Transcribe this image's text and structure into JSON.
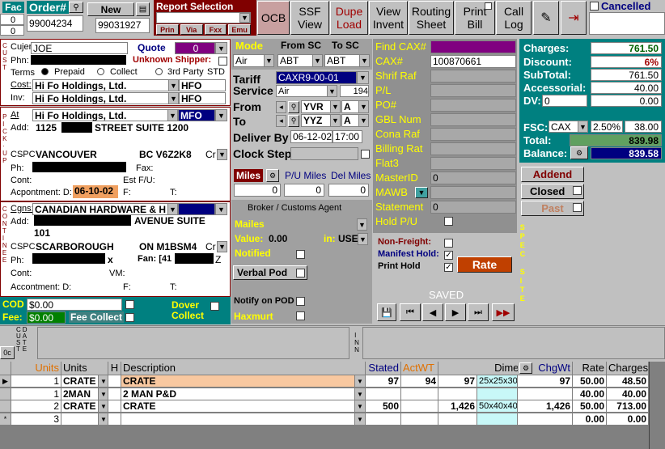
{
  "toolbar": {
    "fac_label": "Fac",
    "fac_values": [
      "0",
      "0"
    ],
    "order_label": "Order#",
    "order_value": "99004234",
    "new_label": "New",
    "new_value": "99031927",
    "report_title": "Report Selection",
    "report_buttons": [
      "Prin",
      "Via",
      "Fxx",
      "Emu"
    ],
    "buttons": [
      {
        "l1": "OCB",
        "l2": ""
      },
      {
        "l1": "SSF",
        "l2": "View"
      },
      {
        "l1": "Dupe",
        "l2": "Load"
      },
      {
        "l1": "View",
        "l2": "Invent"
      },
      {
        "l1": "Routing",
        "l2": "Sheet"
      },
      {
        "l1": "Print",
        "l2": "Bill"
      },
      {
        "l1": "Call",
        "l2": "Log"
      }
    ],
    "cancelled_label": "Cancelled"
  },
  "cust": {
    "side": "CUST",
    "cujer_label": "Cujer",
    "cujer_value": "JOE",
    "quote_label": "Quote",
    "quote_value": "0",
    "phn_label": "Phn:",
    "unknown_shipper": "Unknown Shipper:",
    "terms_label": "Terms",
    "terms": [
      "Prepaid",
      "Collect",
      "3rd Party"
    ],
    "std": "STD",
    "cost_label": "Cost:",
    "cost_value": "Hi Fo Holdings, Ltd.",
    "cost_code": "HFO",
    "inv_label": "Inv:",
    "inv_value": "Hi Fo Holdings, Ltd.",
    "inv_code": "HFO"
  },
  "pickup": {
    "side": "PICK-UP",
    "at_label": "At",
    "at_value": "Hi Fo Holdings, Ltd.",
    "at_code": "MFO",
    "add_label": "Add:",
    "add_pre": "1125",
    "add_post": "STREET SUITE 1200",
    "cspc_label": "CSPC",
    "city": "VANCOUVER",
    "prov": "BC V6Z2K8",
    "cr": "Cr",
    "ph_label": "Ph:",
    "fax_label": "Fax:",
    "cont_label": "Cont:",
    "estfu_label": "Est F/U:",
    "appt_label": "Acpontment: D:",
    "appt_date": "06-10-02",
    "f_label": "F:",
    "t_label": "T:"
  },
  "consignee": {
    "side": "CONTINEE",
    "cgns_label": "Cgns:",
    "cgns_value": "CANADIAN HARDWARE & H",
    "add_label": "Add:",
    "add_post": "AVENUE SUITE",
    "add_line2": "101",
    "cspc_label": "CSPC",
    "city": "SCARBOROUGH",
    "prov": "ON M1BSM4",
    "cr": "Cr",
    "ph_label": "Ph:",
    "ph_suffix": "x",
    "fax_label": "Fan: [41",
    "fax_suffix": "Z",
    "cont_label": "Cont:",
    "vm_label": "VM:",
    "appt_label": "Accontment: D:",
    "f_label": "F:",
    "t_label": "T:"
  },
  "cod": {
    "cod_label": "COD",
    "cod_value": "$0.00",
    "fee_label": "Fee:",
    "fee_value": "$0.00",
    "fee_collect": "Fee Collect",
    "dover": "Dover",
    "collect": "Collect"
  },
  "mode": {
    "title": "Mode",
    "from_label": "From SC",
    "to_label": "To SC",
    "mode_value": "Air",
    "from_value": "ABT",
    "to_value": "ABT"
  },
  "tariff": {
    "tariff_label": "Tariff",
    "tariff_value": "CAXR9-00-01",
    "service_label": "Service",
    "service_value": "Air",
    "service_num": "194",
    "from_label": "From",
    "from_value": "YVR",
    "from_code": "A",
    "to_label": "To",
    "to_value": "YYZ",
    "to_code": "A",
    "deliver_label": "Deliver By",
    "deliver_date": "06-12-02",
    "deliver_time": "17:00",
    "clock_label": "Clock Step"
  },
  "miles": {
    "miles_label": "Miles",
    "pu_label": "P/U Miles",
    "del_label": "Del Miles",
    "miles_value": "0",
    "pu_value": "0",
    "del_value": "0"
  },
  "broker": {
    "title": "Broker / Customs Agent",
    "mailes": "Mailes",
    "value_label": "Value:",
    "value": "0.00",
    "in_label": "in:",
    "currency": "USE",
    "notified": "Notified",
    "verbal": "Verbal Pod",
    "notify_pod": "Notify on POD",
    "haxmurt": "Haxmurt"
  },
  "refs": {
    "labels": [
      "Find CAX#",
      "CAX#",
      "Shrif Raf",
      "P/L",
      "PO#",
      "GBL Num",
      "Cona Raf",
      "Billing Rat",
      "Flat3",
      "MasterID",
      "MAWB",
      "Statement",
      "Hold P/U"
    ],
    "cax_value": "100870661",
    "masterid_value": "0",
    "statement_value": "0"
  },
  "flags": {
    "nonfreight": "Non-Freight:",
    "manifest": "Manifest Hold:",
    "printhold": "Print Hold",
    "rate": "Rate",
    "saved": "SAVED",
    "spec_site": "SPEC SITE"
  },
  "charges": {
    "charges_label": "Charges:",
    "charges_value": "761.50",
    "discount_label": "Discount:",
    "discount_value": "6%",
    "subtotal_label": "SubTotal:",
    "subtotal_value": "761.50",
    "accessorial_label": "Accessorial:",
    "accessorial_value": "40.00",
    "dv_label": "DV:",
    "dv_value": "0",
    "dv_amount": "0.00",
    "fsc_label": "FSC:",
    "fsc_type": "CAX",
    "fsc_pct": "2.50%",
    "fsc_value": "38.00",
    "total_label": "Total:",
    "total_value": "839.98",
    "balance_label": "Balance:",
    "balance_value": "839.58",
    "addend": "Addend",
    "closed": "Closed",
    "past": "Past"
  },
  "grid": {
    "headers": [
      "Units",
      "Units",
      "H",
      "Description",
      "Stated",
      "ActWT",
      "Dimensions",
      "ChgWt",
      "Rate",
      "Charges"
    ],
    "rows": [
      {
        "n": "1",
        "unit": "CRATE",
        "desc": "CRATE",
        "stated": "97",
        "actwt": "94",
        "dimv": "97",
        "dims": "25x25x30",
        "chgwt": "97",
        "rate": "50.00",
        "charge": "48.50"
      },
      {
        "n": "1",
        "unit": "2MAN",
        "desc": "2 MAN P&D",
        "stated": "",
        "actwt": "",
        "dimv": "",
        "dims": "",
        "chgwt": "",
        "rate": "40.00",
        "charge": "40.00"
      },
      {
        "n": "2",
        "unit": "CRATE",
        "desc": "CRATE",
        "stated": "500",
        "actwt": "",
        "dimv": "1,426",
        "dims": "50x40x40",
        "chgwt": "1,426",
        "rate": "50.00",
        "charge": "713.00"
      },
      {
        "n": "3",
        "unit": "",
        "desc": "",
        "stated": "",
        "actwt": "",
        "dimv": "",
        "dims": "",
        "chgwt": "",
        "rate": "0.00",
        "charge": "0.00"
      }
    ]
  },
  "notes": {
    "cust_date": "CUST DATE",
    "inn": "INN",
    "oc": "0c"
  },
  "colors": {
    "teal": "#008080",
    "maroon": "#800000",
    "charges_bg": "#008080",
    "balance_bg": "#000080",
    "orange": "#f08030",
    "cyan": "#c8f8f8"
  }
}
